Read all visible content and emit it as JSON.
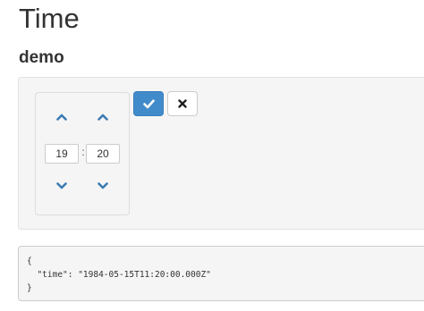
{
  "page": {
    "title": "Time"
  },
  "demo": {
    "heading": "demo",
    "picker": {
      "hours": "19",
      "separator": ":",
      "minutes": "20",
      "icons": {
        "increment": "chevron-up-icon",
        "decrement": "chevron-down-icon"
      }
    },
    "buttons": {
      "confirm_icon": "check-icon",
      "cancel_icon": "close-icon"
    },
    "colors": {
      "accent": "#428bca",
      "chevron": "#3c7bb3"
    }
  },
  "output": {
    "lines": [
      "{",
      "  \"time\": \"1984-05-15T11:20:00.000Z\"",
      "}"
    ]
  }
}
